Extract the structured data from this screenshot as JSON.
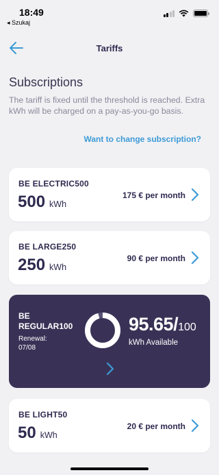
{
  "status": {
    "time": "18:49",
    "back_app": "◂ Szukaj"
  },
  "nav": {
    "title": "Tariffs"
  },
  "subscriptions": {
    "title": "Subscriptions",
    "description": "The tariff is fixed until the threshold is reached. Extra kWh will be charged on a pay-as-you-go basis.",
    "change_link": "Want to change subscription?"
  },
  "plans": [
    {
      "name": "BE ELECTRIC500",
      "kwh": "500",
      "unit": "kWh",
      "price": "175 € per month"
    },
    {
      "name": "BE LARGE250",
      "kwh": "250",
      "unit": "kWh",
      "price": "90 € per month"
    },
    {
      "name": "BE LIGHT50",
      "kwh": "50",
      "unit": "kWh",
      "price": "20 € per month"
    }
  ],
  "active_plan": {
    "name": "BE REGULAR100",
    "renewal_label": "Renewal:",
    "renewal_date": "07/08",
    "available": "95.65/",
    "total": "100",
    "available_label": "kWh Available",
    "fraction_available": 0.9565
  },
  "colors": {
    "accent": "#3d9bd6",
    "dark": "#393256",
    "text": "#2e2a4f",
    "background": "#f1f1f4"
  }
}
